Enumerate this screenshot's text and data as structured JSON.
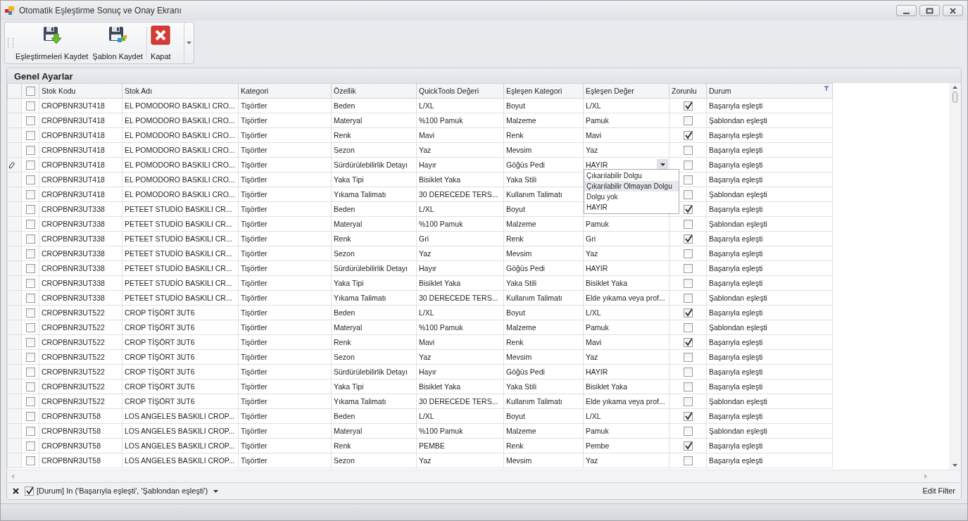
{
  "window": {
    "title": "Otomatik Eşleştirme Sonuç ve Onay Ekranı"
  },
  "toolbar": [
    {
      "kind": "save-arrow",
      "label": "Eşleştirmeleri Kaydet"
    },
    {
      "kind": "save-template",
      "label": "Şablon Kaydet"
    },
    {
      "kind": "close",
      "label": "Kapat"
    }
  ],
  "group": {
    "title": "Genel Ayarlar"
  },
  "table": {
    "select_all_checked": false,
    "columns": [
      "Stok Kodu",
      "Stok Adı",
      "Kategori",
      "Özellik",
      "QuickTools Değeri",
      "Eşleşen Kategori",
      "Eşleşen Değer",
      "Zorunlu",
      "Durum"
    ],
    "rows": [
      {
        "checked": false,
        "editing": false,
        "cells": [
          "CROPBNR3UT418",
          "EL POMODORO BASKILI CRO...",
          "Tişörtler",
          "Beden",
          "L/XL",
          "Boyut",
          "L/XL"
        ],
        "required": true,
        "status": "Başarıyla eşleşti"
      },
      {
        "checked": false,
        "editing": false,
        "cells": [
          "CROPBNR3UT418",
          "EL POMODORO BASKILI CRO...",
          "Tişörtler",
          "Materyal",
          "%100 Pamuk",
          "Malzeme",
          "Pamuk"
        ],
        "required": false,
        "status": "Şablondan eşleşti"
      },
      {
        "checked": false,
        "editing": false,
        "cells": [
          "CROPBNR3UT418",
          "EL POMODORO BASKILI CRO...",
          "Tişörtler",
          "Renk",
          "Mavi",
          "Renk",
          "Mavi"
        ],
        "required": true,
        "status": "Başarıyla eşleşti"
      },
      {
        "checked": false,
        "editing": false,
        "cells": [
          "CROPBNR3UT418",
          "EL POMODORO BASKILI CRO...",
          "Tişörtler",
          "Sezon",
          "Yaz",
          "Mevsim",
          "Yaz"
        ],
        "required": false,
        "status": "Başarıyla eşleşti"
      },
      {
        "checked": false,
        "editing": true,
        "cells": [
          "CROPBNR3UT418",
          "EL POMODORO BASKILI CRO...",
          "Tişörtler",
          "Sürdürülebilirlik Detayı",
          "Hayır",
          "Göğüs Pedi",
          "HAYIR"
        ],
        "required": false,
        "status": "Başarıyla eşleşti"
      },
      {
        "checked": false,
        "editing": false,
        "cells": [
          "CROPBNR3UT418",
          "EL POMODORO BASKILI CRO...",
          "Tişörtler",
          "Yaka Tipi",
          "Bisiklet Yaka",
          "Yaka Stili"
        ],
        "required": false,
        "status": "Başarıyla eşleşti"
      },
      {
        "checked": false,
        "editing": false,
        "cells": [
          "CROPBNR3UT418",
          "EL POMODORO BASKILI CRO...",
          "Tişörtler",
          "Yıkama Talimatı",
          "30 DERECEDE TERS...",
          "Kullanım Talimatı"
        ],
        "required": false,
        "status": "Şablondan eşleşti"
      },
      {
        "checked": false,
        "editing": false,
        "cells": [
          "CROPBNR3UT338",
          "PETEET STUDİO BASKILI CR...",
          "Tişörtler",
          "Beden",
          "L/XL",
          "Boyut"
        ],
        "required": true,
        "status": "Başarıyla eşleşti"
      },
      {
        "checked": false,
        "editing": false,
        "cells": [
          "CROPBNR3UT338",
          "PETEET STUDİO BASKILI CR...",
          "Tişörtler",
          "Materyal",
          "%100 Pamuk",
          "Malzeme",
          "Pamuk"
        ],
        "required": false,
        "status": "Şablondan eşleşti"
      },
      {
        "checked": false,
        "editing": false,
        "cells": [
          "CROPBNR3UT338",
          "PETEET STUDİO BASKILI CR...",
          "Tişörtler",
          "Renk",
          "Gri",
          "Renk",
          "Gri"
        ],
        "required": true,
        "status": "Başarıyla eşleşti"
      },
      {
        "checked": false,
        "editing": false,
        "cells": [
          "CROPBNR3UT338",
          "PETEET STUDİO BASKILI CR...",
          "Tişörtler",
          "Sezon",
          "Yaz",
          "Mevsim",
          "Yaz"
        ],
        "required": false,
        "status": "Başarıyla eşleşti"
      },
      {
        "checked": false,
        "editing": false,
        "cells": [
          "CROPBNR3UT338",
          "PETEET STUDİO BASKILI CR...",
          "Tişörtler",
          "Sürdürülebilirlik Detayı",
          "Hayır",
          "Göğüs Pedi",
          "HAYIR"
        ],
        "required": false,
        "status": "Başarıyla eşleşti"
      },
      {
        "checked": false,
        "editing": false,
        "cells": [
          "CROPBNR3UT338",
          "PETEET STUDİO BASKILI CR...",
          "Tişörtler",
          "Yaka Tipi",
          "Bisiklet Yaka",
          "Yaka Stili",
          "Bisiklet Yaka"
        ],
        "required": false,
        "status": "Başarıyla eşleşti"
      },
      {
        "checked": false,
        "editing": false,
        "cells": [
          "CROPBNR3UT338",
          "PETEET STUDİO BASKILI CR...",
          "Tişörtler",
          "Yıkama Talimatı",
          "30 DERECEDE TERS...",
          "Kullanım Talimatı",
          "Elde yıkama veya prof..."
        ],
        "required": false,
        "status": "Şablondan eşleşti"
      },
      {
        "checked": false,
        "editing": false,
        "cells": [
          "CROPBNR3UT522",
          "CROP TİŞÖRT 3UT6",
          "Tişörtler",
          "Beden",
          "L/XL",
          "Boyut",
          "L/XL"
        ],
        "required": true,
        "status": "Başarıyla eşleşti"
      },
      {
        "checked": false,
        "editing": false,
        "cells": [
          "CROPBNR3UT522",
          "CROP TİŞÖRT 3UT6",
          "Tişörtler",
          "Materyal",
          "%100 Pamuk",
          "Malzeme",
          "Pamuk"
        ],
        "required": false,
        "status": "Şablondan eşleşti"
      },
      {
        "checked": false,
        "editing": false,
        "cells": [
          "CROPBNR3UT522",
          "CROP TİŞÖRT 3UT6",
          "Tişörtler",
          "Renk",
          "Mavi",
          "Renk",
          "Mavi"
        ],
        "required": true,
        "status": "Başarıyla eşleşti"
      },
      {
        "checked": false,
        "editing": false,
        "cells": [
          "CROPBNR3UT522",
          "CROP TİŞÖRT 3UT6",
          "Tişörtler",
          "Sezon",
          "Yaz",
          "Mevsim",
          "Yaz"
        ],
        "required": false,
        "status": "Başarıyla eşleşti"
      },
      {
        "checked": false,
        "editing": false,
        "cells": [
          "CROPBNR3UT522",
          "CROP TİŞÖRT 3UT6",
          "Tişörtler",
          "Sürdürülebilirlik Detayı",
          "Hayır",
          "Göğüs Pedi",
          "HAYIR"
        ],
        "required": false,
        "status": "Başarıyla eşleşti"
      },
      {
        "checked": false,
        "editing": false,
        "cells": [
          "CROPBNR3UT522",
          "CROP TİŞÖRT 3UT6",
          "Tişörtler",
          "Yaka Tipi",
          "Bisiklet Yaka",
          "Yaka Stili",
          "Bisiklet Yaka"
        ],
        "required": false,
        "status": "Başarıyla eşleşti"
      },
      {
        "checked": false,
        "editing": false,
        "cells": [
          "CROPBNR3UT522",
          "CROP TİŞÖRT 3UT6",
          "Tişörtler",
          "Yıkama Talimatı",
          "30 DERECEDE TERS...",
          "Kullanım Talimatı",
          "Elde yıkama veya prof..."
        ],
        "required": false,
        "status": "Şablondan eşleşti"
      },
      {
        "checked": false,
        "editing": false,
        "cells": [
          "CROPBNR3UT58",
          "LOS ANGELES BASKILI CROP...",
          "Tişörtler",
          "Beden",
          "L/XL",
          "Boyut",
          "L/XL"
        ],
        "required": true,
        "status": "Başarıyla eşleşti"
      },
      {
        "checked": false,
        "editing": false,
        "cells": [
          "CROPBNR3UT58",
          "LOS ANGELES BASKILI CROP...",
          "Tişörtler",
          "Materyal",
          "%100 Pamuk",
          "Malzeme",
          "Pamuk"
        ],
        "required": false,
        "status": "Şablondan eşleşti"
      },
      {
        "checked": false,
        "editing": false,
        "cells": [
          "CROPBNR3UT58",
          "LOS ANGELES BASKILI CROP...",
          "Tişörtler",
          "Renk",
          "PEMBE",
          "Renk",
          "Pembe"
        ],
        "required": true,
        "status": "Başarıyla eşleşti"
      },
      {
        "checked": false,
        "editing": false,
        "cells": [
          "CROPBNR3UT58",
          "LOS ANGELES BASKILI CROP...",
          "Tişörtler",
          "Sezon",
          "Yaz",
          "Mevsim",
          "Yaz"
        ],
        "required": false,
        "status": "Başarıyla eşleşti"
      }
    ]
  },
  "dropdown": {
    "options": [
      {
        "label": "Çıkarılabilir Dolgu",
        "selected": false
      },
      {
        "label": "Çıkarılabilir Olmayan Dolgu",
        "selected": true
      },
      {
        "label": "Dolgu yok",
        "selected": false
      },
      {
        "label": "HAYIR",
        "selected": false
      }
    ]
  },
  "filter": {
    "enabled": true,
    "expression": "[Durum] In ('Başarıyla eşleşti', 'Şablondan eşleşti')",
    "edit_link": "Edit Filter"
  }
}
